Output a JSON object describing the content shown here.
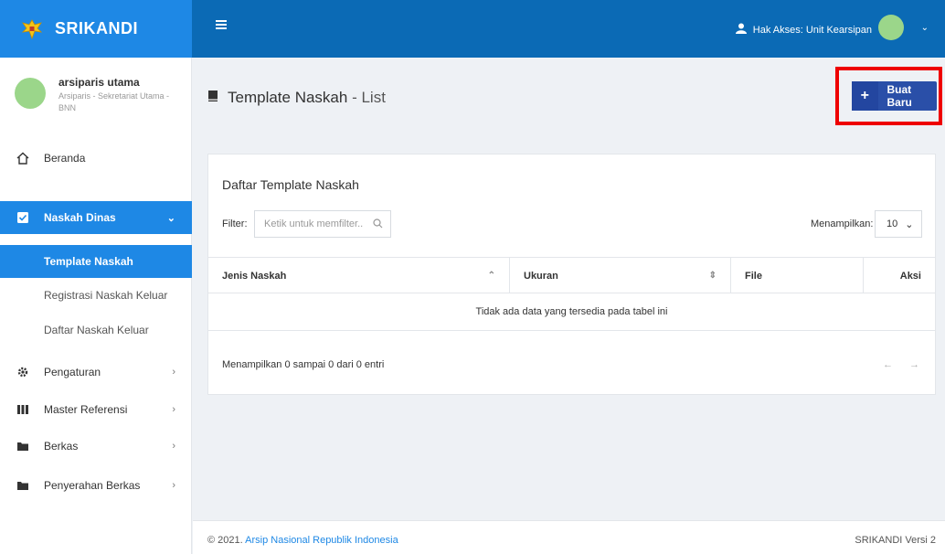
{
  "header": {
    "brand_name": "SRIKANDI",
    "access_label": "Hak Akses: Unit Kearsipan"
  },
  "user": {
    "name": "arsiparis utama",
    "role": "Arsiparis - Sekretariat Utama - BNN"
  },
  "sidebar": {
    "items": [
      {
        "label": "Beranda",
        "icon": "home-icon"
      },
      {
        "label": "Naskah Dinas",
        "icon": "checkbox-icon"
      },
      {
        "label": "Pengaturan",
        "icon": "gear-icon"
      },
      {
        "label": "Master Referensi",
        "icon": "grid-icon"
      },
      {
        "label": "Berkas",
        "icon": "folder-icon"
      },
      {
        "label": "Penyerahan Berkas",
        "icon": "folder-icon"
      }
    ],
    "submenu": [
      {
        "label": "Template Naskah"
      },
      {
        "label": "Registrasi Naskah Keluar"
      },
      {
        "label": "Daftar Naskah Keluar"
      }
    ]
  },
  "page": {
    "title": "Template Naskah",
    "subtitle": "- List",
    "new_button": "Buat Baru"
  },
  "card": {
    "title": "Daftar Template Naskah",
    "filter_label": "Filter:",
    "filter_placeholder": "Ketik untuk memfilter...",
    "show_label": "Menampilkan:",
    "show_value": "10",
    "columns": [
      "Jenis Naskah",
      "Ukuran",
      "File",
      "Aksi"
    ],
    "empty_message": "Tidak ada data yang tersedia pada tabel ini",
    "info": "Menampilkan 0 sampai 0 dari 0 entri",
    "pager_prev": "←",
    "pager_next": "→"
  },
  "footer": {
    "copyright": "© 2021.",
    "org": "Arsip Nasional Republik Indonesia",
    "version": "SRIKANDI Versi 2"
  },
  "colors": {
    "topbar": "#0b6ab5",
    "brand": "#1e88e5",
    "active": "#1e88e5",
    "button": "#2a4fa8",
    "highlight": "#ee0000"
  }
}
